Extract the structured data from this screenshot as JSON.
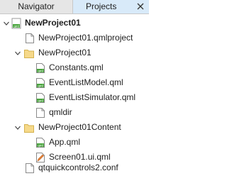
{
  "tabs": {
    "navigator": "Navigator",
    "projects": "Projects"
  },
  "tree": {
    "root": "NewProject01",
    "qmlproject": "NewProject01.qmlproject",
    "folder1": "NewProject01",
    "constants": "Constants.qml",
    "event_model": "EventListModel.qml",
    "event_sim": "EventListSimulator.qml",
    "qmldir": "qmldir",
    "folder2": "NewProject01Content",
    "app": "App.qml",
    "screen": "Screen01.ui.qml",
    "conf": "qtquickcontrols2.conf"
  },
  "colors": {
    "folder": "#f6d98a",
    "active_tab": "#d8eaf9",
    "qml_badge": "#48a43c"
  }
}
